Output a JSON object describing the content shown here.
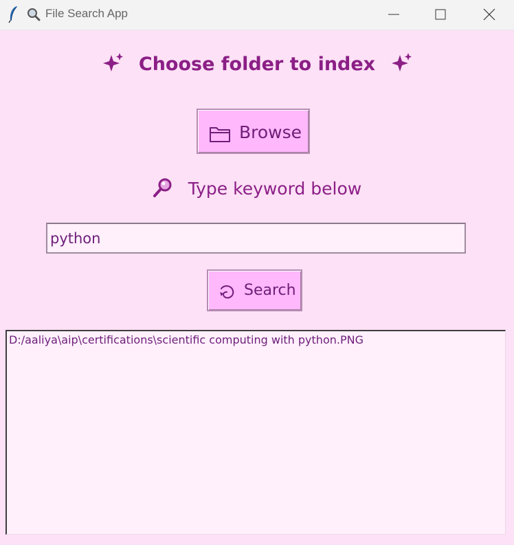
{
  "window": {
    "title": "File Search App",
    "title_glyph": "magnifier-icon",
    "app_icon": "tk-feather-icon",
    "controls": [
      "minimize",
      "maximize",
      "close"
    ]
  },
  "heading": {
    "text": "Choose folder to index",
    "decoration": "sparkles-icon"
  },
  "browse": {
    "label": "Browse",
    "icon": "folder-icon"
  },
  "keyword": {
    "label": "Type keyword below",
    "icon": "magnifier-icon"
  },
  "search": {
    "value": "python",
    "button_label": "Search",
    "button_icon": "swirl-icon"
  },
  "results": {
    "items": [
      "D:/aaliya\\aip\\certifications\\scientific computing with python.PNG"
    ]
  },
  "colors": {
    "background": "#fde1f6",
    "button": "#ffb8fb",
    "text": "#8b1f86",
    "input_bg": "#fff0fb"
  }
}
